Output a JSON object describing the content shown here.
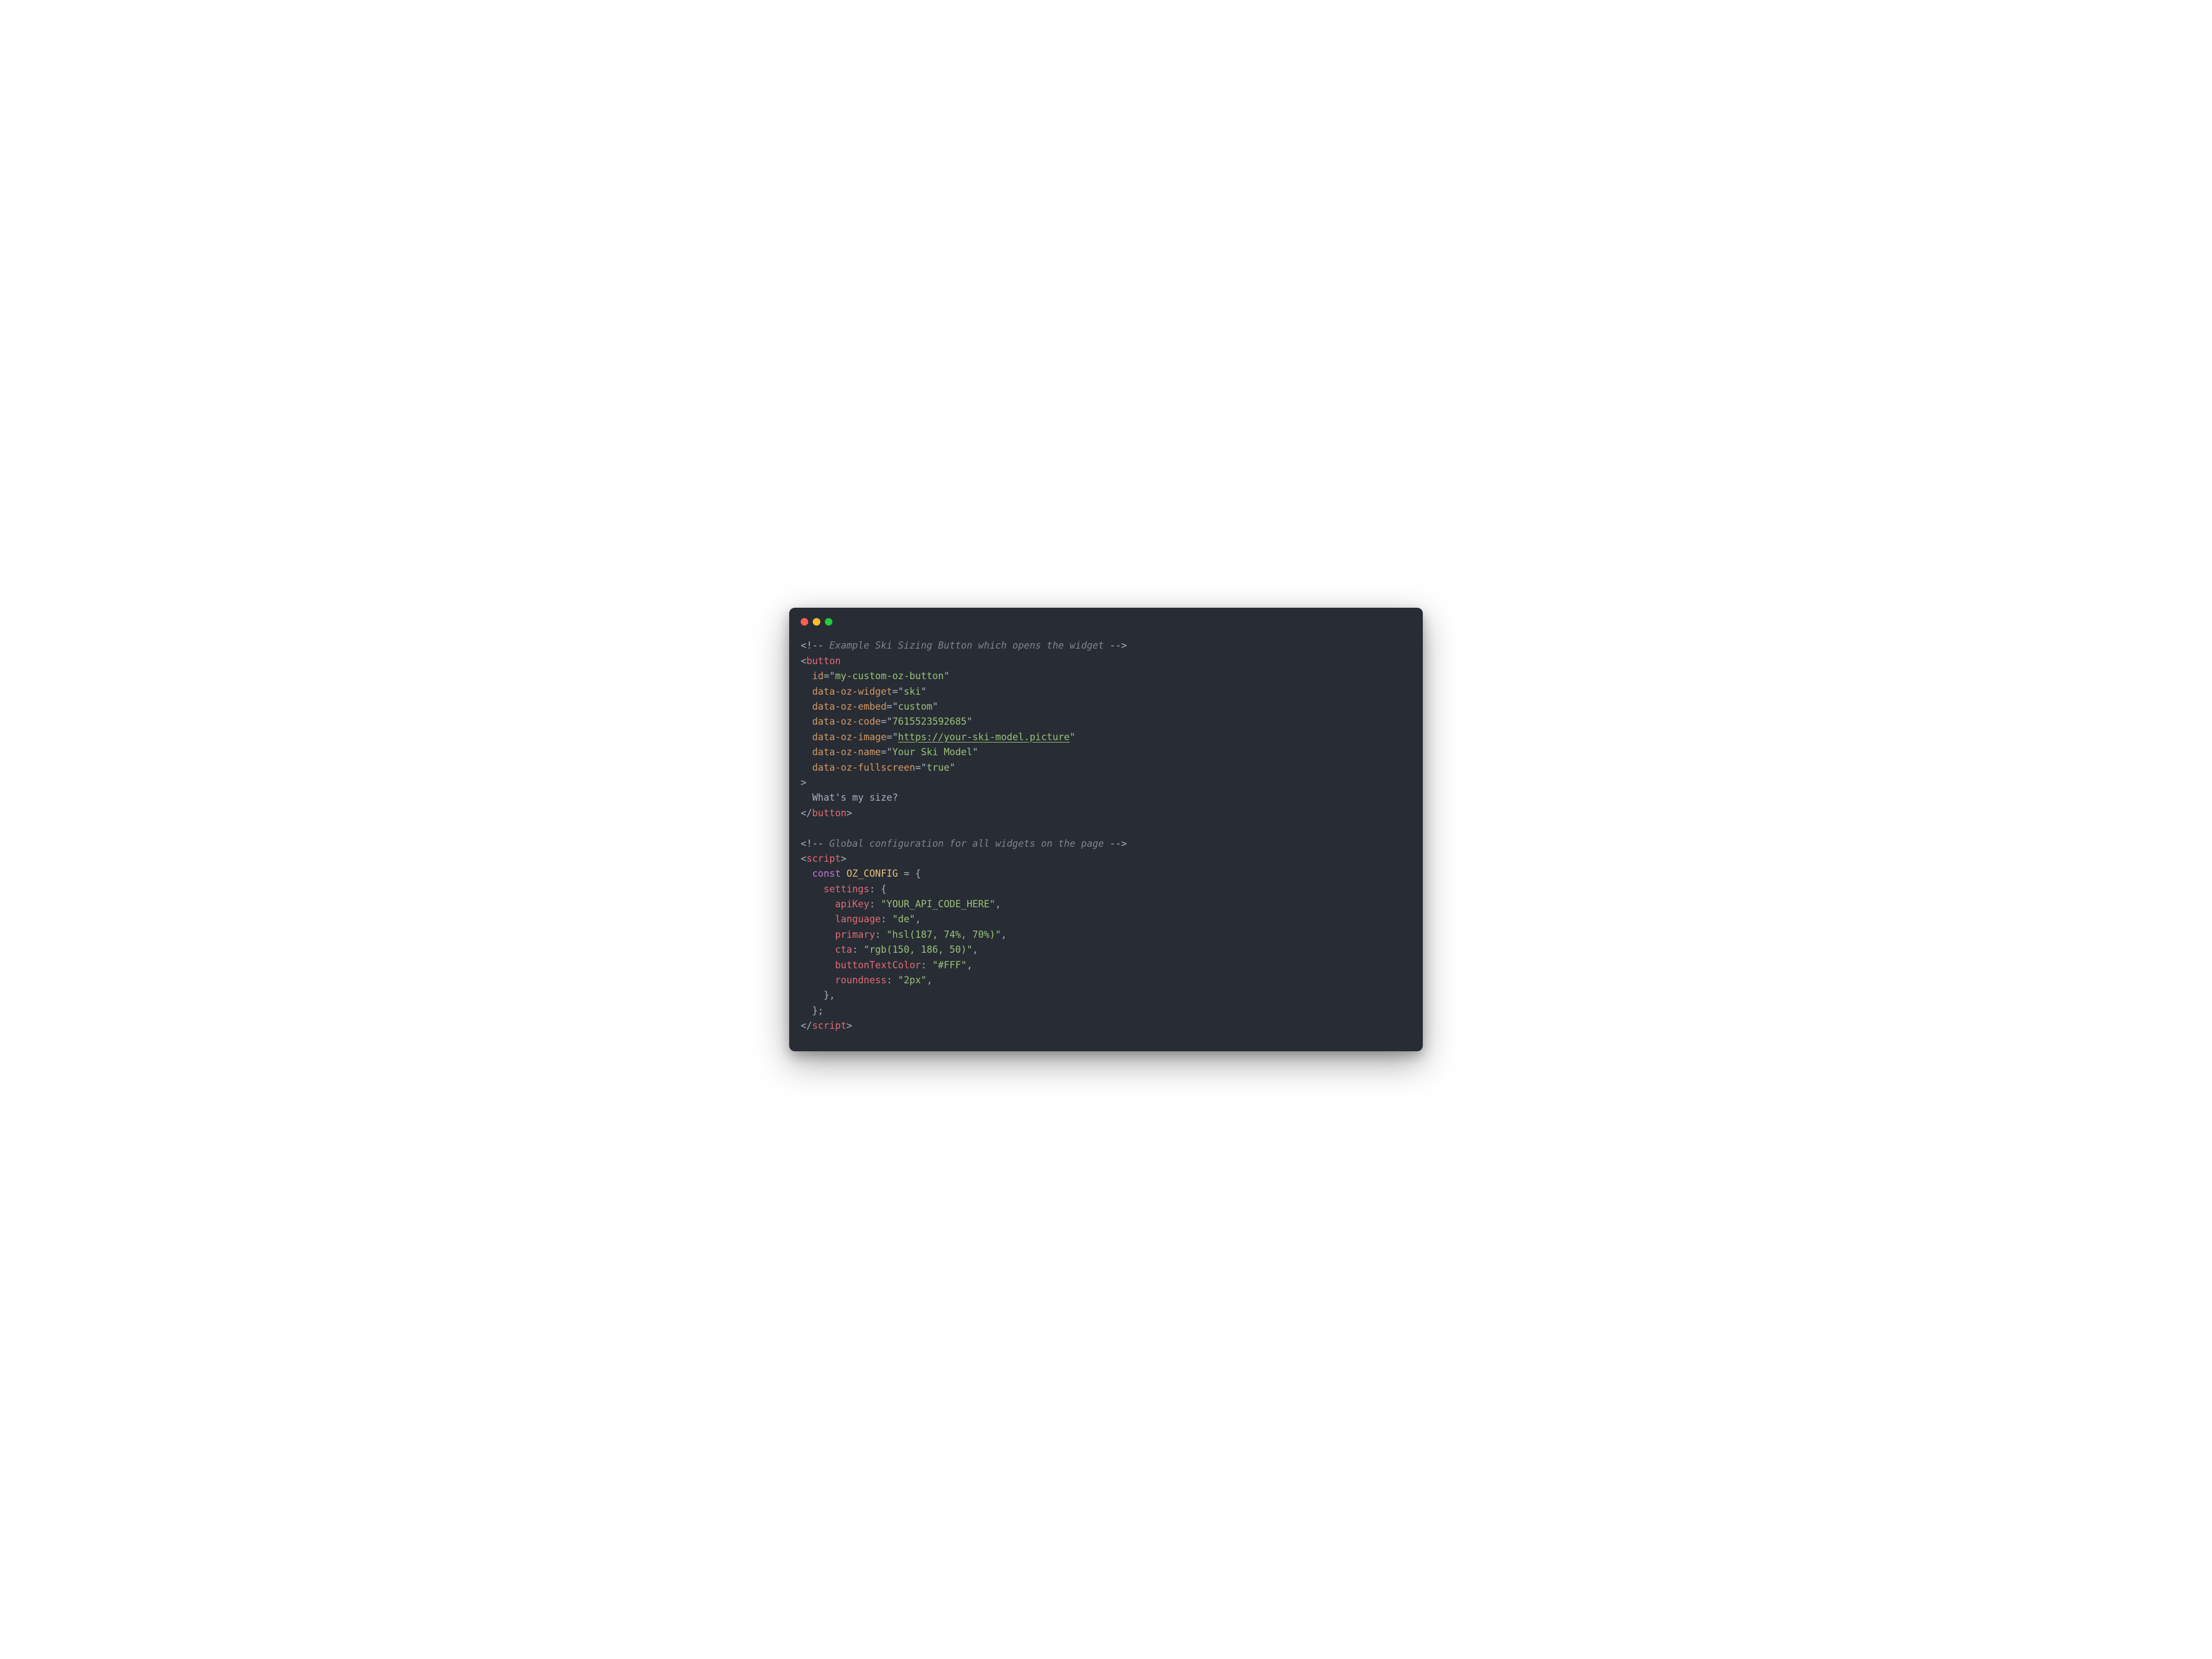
{
  "window": {
    "traffic_lights": [
      "close",
      "minimize",
      "zoom"
    ]
  },
  "code": {
    "lines": [
      [
        {
          "cls": "c-punct",
          "t": "<!-- "
        },
        {
          "cls": "c-comment",
          "t": "Example Ski Sizing Button which opens the widget"
        },
        {
          "cls": "c-punct",
          "t": " -->"
        }
      ],
      [
        {
          "cls": "c-punct",
          "t": "<"
        },
        {
          "cls": "c-tag",
          "t": "button"
        }
      ],
      [
        {
          "cls": "",
          "t": "  "
        },
        {
          "cls": "c-attr",
          "t": "id"
        },
        {
          "cls": "c-op",
          "t": "="
        },
        {
          "cls": "c-punct",
          "t": "\""
        },
        {
          "cls": "c-string",
          "t": "my-custom-oz-button"
        },
        {
          "cls": "c-punct",
          "t": "\""
        }
      ],
      [
        {
          "cls": "",
          "t": "  "
        },
        {
          "cls": "c-attr",
          "t": "data-oz-widget"
        },
        {
          "cls": "c-op",
          "t": "="
        },
        {
          "cls": "c-punct",
          "t": "\""
        },
        {
          "cls": "c-string",
          "t": "ski"
        },
        {
          "cls": "c-punct",
          "t": "\""
        }
      ],
      [
        {
          "cls": "",
          "t": "  "
        },
        {
          "cls": "c-attr",
          "t": "data-oz-embed"
        },
        {
          "cls": "c-op",
          "t": "="
        },
        {
          "cls": "c-punct",
          "t": "\""
        },
        {
          "cls": "c-string",
          "t": "custom"
        },
        {
          "cls": "c-punct",
          "t": "\""
        }
      ],
      [
        {
          "cls": "",
          "t": "  "
        },
        {
          "cls": "c-attr",
          "t": "data-oz-code"
        },
        {
          "cls": "c-op",
          "t": "="
        },
        {
          "cls": "c-punct",
          "t": "\""
        },
        {
          "cls": "c-string",
          "t": "7615523592685"
        },
        {
          "cls": "c-punct",
          "t": "\""
        }
      ],
      [
        {
          "cls": "",
          "t": "  "
        },
        {
          "cls": "c-attr",
          "t": "data-oz-image"
        },
        {
          "cls": "c-op",
          "t": "="
        },
        {
          "cls": "c-punct",
          "t": "\""
        },
        {
          "cls": "c-string underlined",
          "t": "https://your-ski-model.picture"
        },
        {
          "cls": "c-punct",
          "t": "\""
        }
      ],
      [
        {
          "cls": "",
          "t": "  "
        },
        {
          "cls": "c-attr",
          "t": "data-oz-name"
        },
        {
          "cls": "c-op",
          "t": "="
        },
        {
          "cls": "c-punct",
          "t": "\""
        },
        {
          "cls": "c-string",
          "t": "Your Ski Model"
        },
        {
          "cls": "c-punct",
          "t": "\""
        }
      ],
      [
        {
          "cls": "",
          "t": "  "
        },
        {
          "cls": "c-attr",
          "t": "data-oz-fullscreen"
        },
        {
          "cls": "c-op",
          "t": "="
        },
        {
          "cls": "c-punct",
          "t": "\""
        },
        {
          "cls": "c-string",
          "t": "true"
        },
        {
          "cls": "c-punct",
          "t": "\""
        }
      ],
      [
        {
          "cls": "c-punct",
          "t": ">"
        }
      ],
      [
        {
          "cls": "",
          "t": "  "
        },
        {
          "cls": "c-text",
          "t": "What's my size?"
        }
      ],
      [
        {
          "cls": "c-punct",
          "t": "</"
        },
        {
          "cls": "c-tag",
          "t": "button"
        },
        {
          "cls": "c-punct",
          "t": ">"
        }
      ],
      [
        {
          "cls": "",
          "t": ""
        }
      ],
      [
        {
          "cls": "c-punct",
          "t": "<!-- "
        },
        {
          "cls": "c-comment",
          "t": "Global configuration for all widgets on the page"
        },
        {
          "cls": "c-punct",
          "t": " -->"
        }
      ],
      [
        {
          "cls": "c-punct",
          "t": "<"
        },
        {
          "cls": "c-tag",
          "t": "script"
        },
        {
          "cls": "c-punct",
          "t": ">"
        }
      ],
      [
        {
          "cls": "",
          "t": "  "
        },
        {
          "cls": "c-keyword",
          "t": "const"
        },
        {
          "cls": "",
          "t": " "
        },
        {
          "cls": "c-const",
          "t": "OZ_CONFIG"
        },
        {
          "cls": "",
          "t": " "
        },
        {
          "cls": "c-op",
          "t": "="
        },
        {
          "cls": "",
          "t": " "
        },
        {
          "cls": "c-punct",
          "t": "{"
        }
      ],
      [
        {
          "cls": "",
          "t": "    "
        },
        {
          "cls": "c-key",
          "t": "settings"
        },
        {
          "cls": "c-op",
          "t": ":"
        },
        {
          "cls": "",
          "t": " "
        },
        {
          "cls": "c-punct",
          "t": "{"
        }
      ],
      [
        {
          "cls": "",
          "t": "      "
        },
        {
          "cls": "c-key",
          "t": "apiKey"
        },
        {
          "cls": "c-op",
          "t": ":"
        },
        {
          "cls": "",
          "t": " "
        },
        {
          "cls": "c-string",
          "t": "\"YOUR_API_CODE_HERE\""
        },
        {
          "cls": "c-punct",
          "t": ","
        }
      ],
      [
        {
          "cls": "",
          "t": "      "
        },
        {
          "cls": "c-key",
          "t": "language"
        },
        {
          "cls": "c-op",
          "t": ":"
        },
        {
          "cls": "",
          "t": " "
        },
        {
          "cls": "c-string",
          "t": "\"de\""
        },
        {
          "cls": "c-punct",
          "t": ","
        }
      ],
      [
        {
          "cls": "",
          "t": "      "
        },
        {
          "cls": "c-key",
          "t": "primary"
        },
        {
          "cls": "c-op",
          "t": ":"
        },
        {
          "cls": "",
          "t": " "
        },
        {
          "cls": "c-string",
          "t": "\"hsl(187, 74%, 70%)\""
        },
        {
          "cls": "c-punct",
          "t": ","
        }
      ],
      [
        {
          "cls": "",
          "t": "      "
        },
        {
          "cls": "c-key",
          "t": "cta"
        },
        {
          "cls": "c-op",
          "t": ":"
        },
        {
          "cls": "",
          "t": " "
        },
        {
          "cls": "c-string",
          "t": "\"rgb(150, 186, 50)\""
        },
        {
          "cls": "c-punct",
          "t": ","
        }
      ],
      [
        {
          "cls": "",
          "t": "      "
        },
        {
          "cls": "c-key",
          "t": "buttonTextColor"
        },
        {
          "cls": "c-op",
          "t": ":"
        },
        {
          "cls": "",
          "t": " "
        },
        {
          "cls": "c-string",
          "t": "\"#FFF\""
        },
        {
          "cls": "c-punct",
          "t": ","
        }
      ],
      [
        {
          "cls": "",
          "t": "      "
        },
        {
          "cls": "c-key",
          "t": "roundness"
        },
        {
          "cls": "c-op",
          "t": ":"
        },
        {
          "cls": "",
          "t": " "
        },
        {
          "cls": "c-string",
          "t": "\"2px\""
        },
        {
          "cls": "c-punct",
          "t": ","
        }
      ],
      [
        {
          "cls": "",
          "t": "    "
        },
        {
          "cls": "c-punct",
          "t": "},"
        }
      ],
      [
        {
          "cls": "",
          "t": "  "
        },
        {
          "cls": "c-punct",
          "t": "};"
        }
      ],
      [
        {
          "cls": "c-punct",
          "t": "</"
        },
        {
          "cls": "c-tag",
          "t": "script"
        },
        {
          "cls": "c-punct",
          "t": ">"
        }
      ]
    ]
  }
}
